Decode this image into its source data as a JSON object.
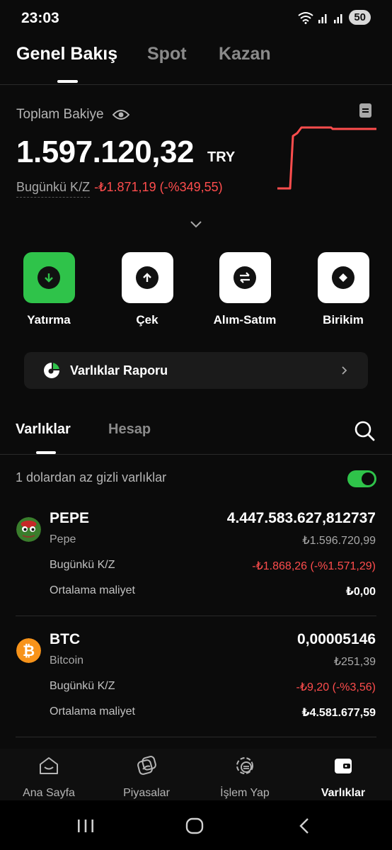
{
  "status_bar": {
    "time": "23:03",
    "battery": "50"
  },
  "top_tabs": [
    {
      "label": "Genel Bakış",
      "active": true
    },
    {
      "label": "Spot",
      "active": false
    },
    {
      "label": "Kazan",
      "active": false
    }
  ],
  "balance": {
    "label": "Toplam Bakiye",
    "amount": "1.597.120,32",
    "currency": "TRY",
    "pnl_label": "Bugünkü K/Z",
    "pnl_value": "-₺1.871,19 (-%349,55)"
  },
  "actions": [
    {
      "label": "Yatırma",
      "icon": "arrow-down-icon"
    },
    {
      "label": "Çek",
      "icon": "arrow-up-icon"
    },
    {
      "label": "Alım-Satım",
      "icon": "swap-icon"
    },
    {
      "label": "Birikim",
      "icon": "diamond-icon"
    }
  ],
  "report": {
    "label": "Varlıklar Raporu"
  },
  "sub_tabs": [
    {
      "label": "Varlıklar",
      "active": true
    },
    {
      "label": "Hesap",
      "active": false
    }
  ],
  "hidden_assets": {
    "label": "1 dolardan az gizli varlıklar",
    "enabled": true
  },
  "assets": [
    {
      "symbol": "PEPE",
      "name": "Pepe",
      "amount": "4.447.583.627,812737",
      "value": "₺1.596.720,99",
      "pnl_label": "Bugünkü K/Z",
      "pnl_value": "-₺1.868,26 (-%1.571,29)",
      "cost_label": "Ortalama maliyet",
      "cost_value": "₺0,00"
    },
    {
      "symbol": "BTC",
      "name": "Bitcoin",
      "amount": "0,00005146",
      "value": "₺251,39",
      "pnl_label": "Bugünkü K/Z",
      "pnl_value": "-₺9,20 (-%3,56)",
      "cost_label": "Ortalama maliyet",
      "cost_value": "₺4.581.677,59"
    }
  ],
  "bottom_nav": [
    {
      "label": "Ana Sayfa",
      "active": false
    },
    {
      "label": "Piyasalar",
      "active": false
    },
    {
      "label": "İşlem Yap",
      "active": false
    },
    {
      "label": "Varlıklar",
      "active": true
    }
  ],
  "colors": {
    "accent_green": "#2fc34a",
    "loss_red": "#ff4d4d",
    "background": "#0b0b0b"
  }
}
